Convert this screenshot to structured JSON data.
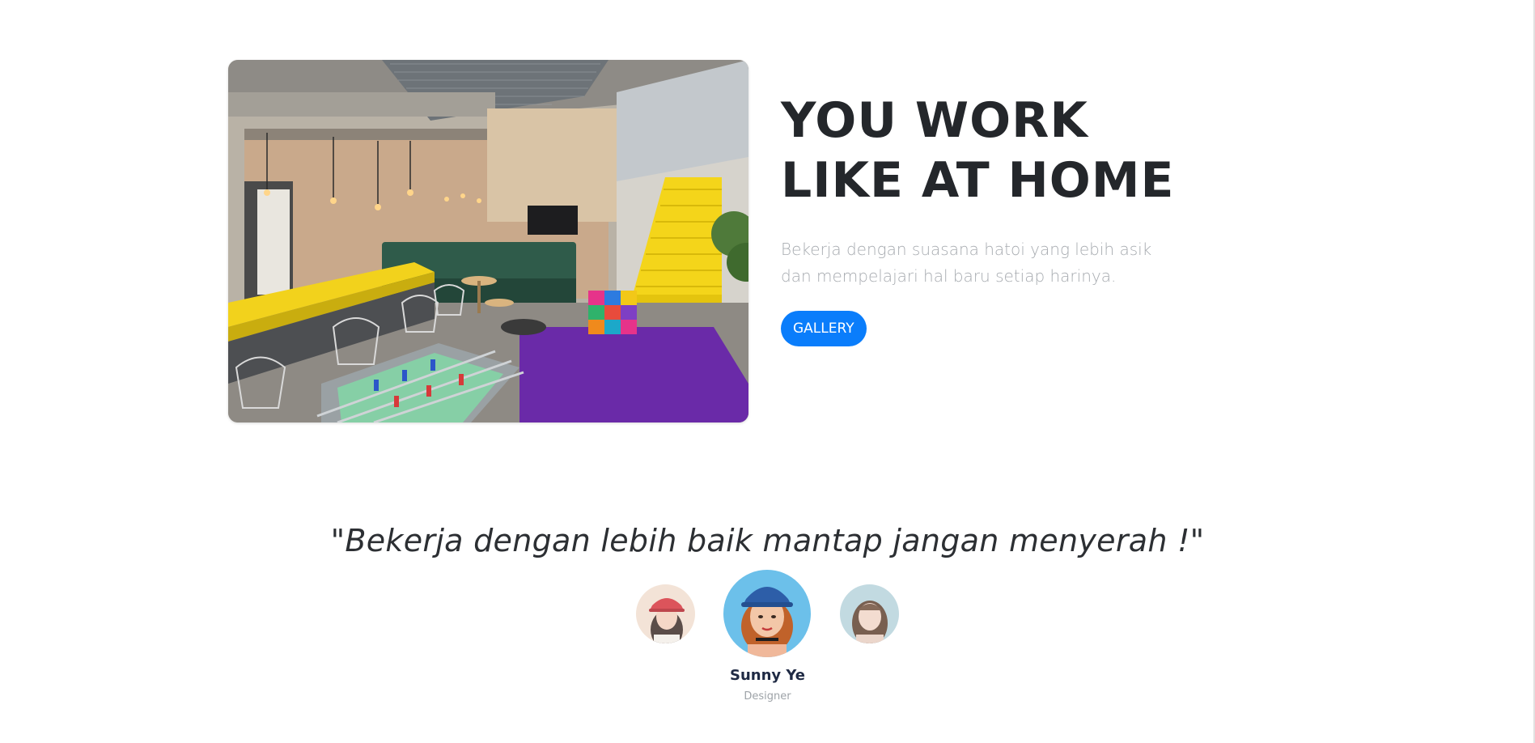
{
  "hero": {
    "title": "YOU WORK LIKE AT HOME",
    "description": "Bekerja dengan suasana hatoi yang lebih asik dan mempelajari hal baru setiap harinya.",
    "button_label": "GALLERY",
    "image_icon": "office-lounge-photo"
  },
  "testimonial": {
    "quote": "\"Bekerja dengan lebih baik mantap jangan menyerah !\"",
    "active_person": {
      "name": "Sunny Ye",
      "role": "Designer"
    },
    "avatars": [
      {
        "name": "avatar-left",
        "active": false
      },
      {
        "name": "avatar-center",
        "active": true
      },
      {
        "name": "avatar-right",
        "active": false
      }
    ]
  },
  "colors": {
    "accent": "#0a7dfb",
    "title": "#24272b",
    "muted_text": "#a7abb0",
    "name_text": "#1f2a44"
  }
}
